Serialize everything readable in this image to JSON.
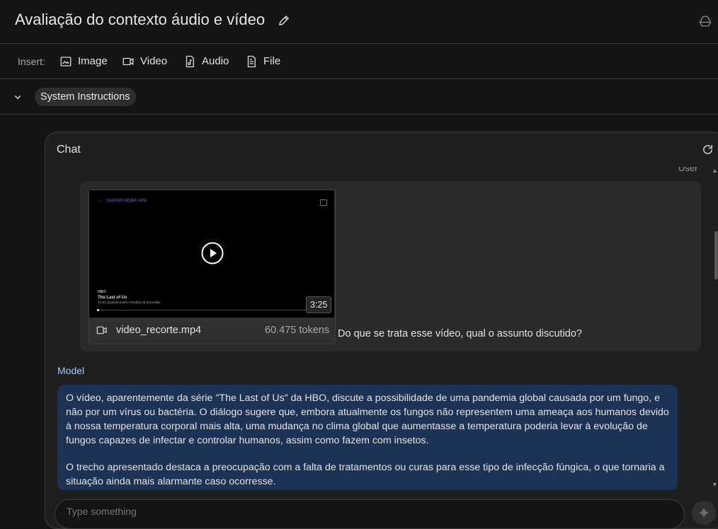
{
  "header": {
    "title": "Avaliação do contexto áudio e vídeo"
  },
  "insert_bar": {
    "label": "Insert:",
    "buttons": [
      {
        "label": "Image",
        "icon": "image-icon"
      },
      {
        "label": "Video",
        "icon": "video-icon"
      },
      {
        "label": "Audio",
        "icon": "audio-file-icon"
      },
      {
        "label": "File",
        "icon": "file-icon"
      }
    ]
  },
  "system_instructions": {
    "label": "System Instructions"
  },
  "chat": {
    "title": "Chat",
    "user_label": "User",
    "video": {
      "classification": "CLASSIFICAÇÃO | A16",
      "network": "HBO",
      "show": "The Last of Us",
      "episode": "T1:E1 Quando Estiver Perdido na Escuridão",
      "duration": "3:25",
      "filename": "video_recorte.mp4",
      "tokens": "60.475 tokens"
    },
    "user_message": "Do que se trata esse vídeo, qual o assunto discutido?",
    "model_label": "Model",
    "model_paragraphs": [
      "O vídeo, aparentemente da série \"The Last of Us\" da HBO, discute a possibilidade de uma pandemia global causada por um fungo, e não por um vírus ou bactéria. O diálogo sugere que, embora atualmente os fungos não representem uma ameaça aos humanos devido à nossa temperatura corporal mais alta, uma mudança no clima global que aumentasse a temperatura poderia levar à evolução de fungos capazes de infectar e controlar humanos, assim como fazem com insetos.",
      "O trecho apresentado destaca a preocupação com a falta de tratamentos ou curas para esse tipo de infecção fúngica, o que tornaria a situação ainda mais alarmante caso ocorresse."
    ],
    "input_placeholder": "Type something"
  },
  "colors": {
    "background": "#141414",
    "panel": "#1f1f1f",
    "model_bubble": "#1c3356",
    "model_label": "#a8c7fa"
  }
}
